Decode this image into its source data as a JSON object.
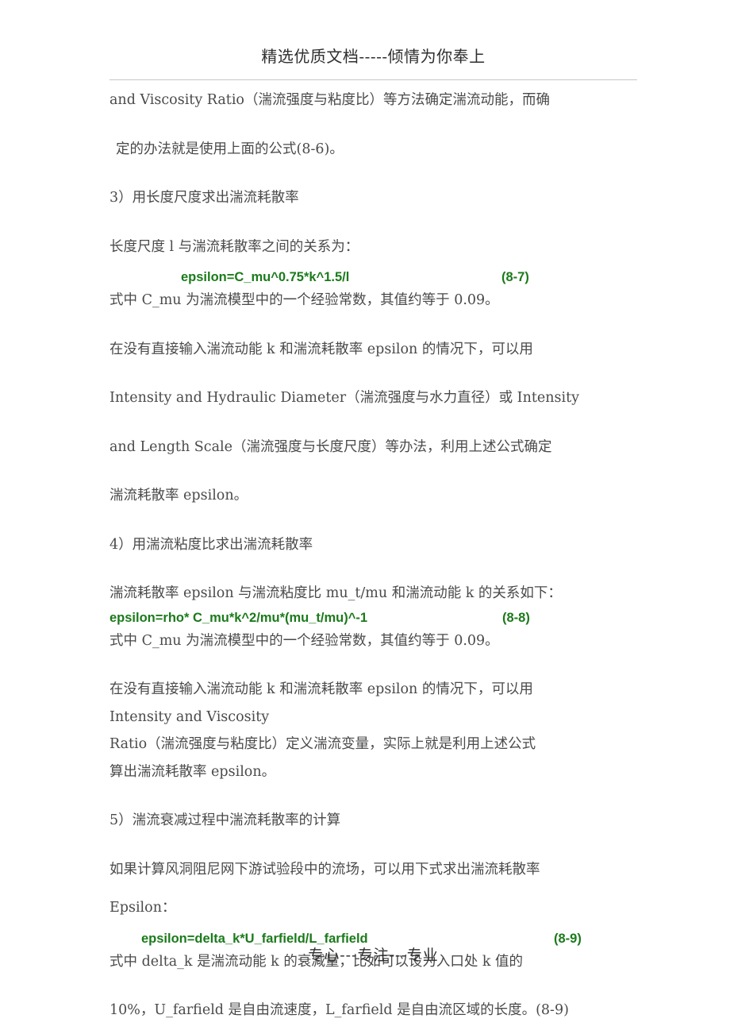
{
  "header": {
    "watermark_text": "精选优质文档-----倾情为你奉上"
  },
  "footer": {
    "watermark_text": "专心---专注---专业"
  },
  "colors": {
    "formula_green": "#1b7a1b",
    "body_text": "#4a4a4a",
    "header_text": "#2e2e2e",
    "rule": "#c8c8c8"
  },
  "body": {
    "lines": {
      "l1": "and Viscosity Ratio（湍流强度与粘度比）等方法确定湍流动能，而确",
      "l2": "定的办法就是使用上面的公式(8-6)。",
      "l3": "3）用长度尺度求出湍流耗散率",
      "l4": "长度尺度 l 与湍流耗散率之间的关系为：",
      "l5": "式中 C_mu 为湍流模型中的一个经验常数，其值约等于 0.09。",
      "l6": "在没有直接输入湍流动能 k 和湍流耗散率 epsilon 的情况下，可以用",
      "l7": "Intensity and Hydraulic Diameter（湍流强度与水力直径）或 Intensity",
      "l8": "and Length Scale（湍流强度与长度尺度）等办法，利用上述公式确定",
      "l9": "湍流耗散率 epsilon。",
      "l10": "4）用湍流粘度比求出湍流耗散率",
      "l11": "湍流耗散率 epsilon 与湍流粘度比 mu_t/mu 和湍流动能 k 的关系如下：",
      "l12": "式中 C_mu 为湍流模型中的一个经验常数，其值约等于 0.09。",
      "l13": "在没有直接输入湍流动能 k 和湍流耗散率 epsilon 的情况下，可以用",
      "l14": "Intensity and Viscosity",
      "l15": "Ratio（湍流强度与粘度比）定义湍流变量，实际上就是利用上述公式",
      "l16": "算出湍流耗散率 epsilon。",
      "l17": "5）湍流衰减过程中湍流耗散率的计算",
      "l18": "如果计算风洞阻尼网下游试验段中的流场，可以用下式求出湍流耗散率",
      "l19": "Epsilon：",
      "l20": "式中 delta_k 是湍流动能 k 的衰减量，比如可以设为入口处 k 值的",
      "l21": "10%，U_farfield 是自由流速度，L_farfield 是自由流区域的长度。(8-9)"
    }
  },
  "formulas": [
    {
      "id": "8-7",
      "expression": "epsilon=C_mu^0.75*k^1.5/l",
      "number": "(8-7)"
    },
    {
      "id": "8-8",
      "expression": "epsilon=rho* C_mu*k^2/mu*(mu_t/mu)^-1",
      "number": "(8-8)"
    },
    {
      "id": "8-9",
      "expression": "epsilon=delta_k*U_farfield/L_farfield",
      "number": "(8-9)"
    }
  ]
}
